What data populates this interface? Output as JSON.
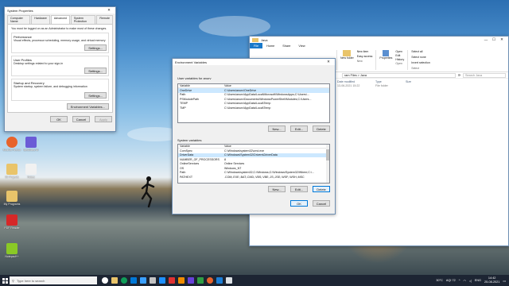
{
  "system_properties": {
    "title": "System Properties",
    "tabs": [
      "Computer Name",
      "Hardware",
      "Advanced",
      "System Protection",
      "Remote"
    ],
    "active_tab": "Advanced",
    "admin_note": "You must be logged on as an Administrator to make most of these changes.",
    "performance": {
      "label": "Performance",
      "desc": "Visual effects, processor scheduling, memory usage, and virtual memory",
      "button": "Settings..."
    },
    "user_profiles": {
      "label": "User Profiles",
      "desc": "Desktop settings related to your sign-in",
      "button": "Settings..."
    },
    "startup": {
      "label": "Startup and Recovery",
      "desc": "System startup, system failure, and debugging information",
      "button": "Settings..."
    },
    "env_button": "Environment Variables...",
    "ok": "OK",
    "cancel": "Cancel",
    "apply": "Apply"
  },
  "env_vars": {
    "title": "Environment Variables",
    "user_section": "User variables for anurv",
    "col_variable": "Variable",
    "col_value": "Value",
    "user_rows": [
      {
        "var": "OneDrive",
        "val": "C:\\Users\\anurv\\OneDrive"
      },
      {
        "var": "Path",
        "val": "C:\\Users\\anurv\\AppData\\Local\\Microsoft\\WindowsApps;C:\\Users\\..."
      },
      {
        "var": "PSModulePath",
        "val": "C:\\Users\\anurv\\Documents\\WindowsPowerShell\\Modules;C:\\Users..."
      },
      {
        "var": "TEMP",
        "val": "C:\\Users\\anurv\\AppData\\Local\\Temp"
      },
      {
        "var": "TMP",
        "val": "C:\\Users\\anurv\\AppData\\Local\\Temp"
      }
    ],
    "system_section": "System variables",
    "system_rows": [
      {
        "var": "ComSpec",
        "val": "C:\\Windows\\system32\\cmd.exe"
      },
      {
        "var": "DriverData",
        "val": "C:\\Windows\\System32\\Drivers\\DriverData"
      },
      {
        "var": "NUMBER_OF_PROCESSORS",
        "val": "8"
      },
      {
        "var": "OnlineServices",
        "val": "Online Services"
      },
      {
        "var": "OS",
        "val": "Windows_NT"
      },
      {
        "var": "Path",
        "val": "C:\\Windows\\system32;C:\\Windows;C:\\Windows\\System32\\Wbem;C:\\..."
      },
      {
        "var": "PATHEXT",
        "val": ".COM;.EXE;.BAT;.CMD;.VBS;.VBE;.JS;.JSE;.WSF;.WSH;.MSC"
      }
    ],
    "new": "New...",
    "edit": "Edit...",
    "delete": "Delete",
    "ok": "OK",
    "cancel": "Cancel"
  },
  "explorer": {
    "title": "Java",
    "ribbon_tabs": [
      "File",
      "Home",
      "Share",
      "View"
    ],
    "new_item": "New item",
    "easy_access": "Easy access",
    "new_folder": "New folder",
    "properties": "Properties",
    "open": "Open",
    "edit": "Edit",
    "history": "History",
    "select_all": "Select all",
    "select_none": "Select none",
    "invert_selection": "Invert selection",
    "organize": "Organize",
    "group_new": "New",
    "group_open": "Open",
    "group_select": "Select",
    "path": "ram Files > Java",
    "search_placeholder": "Search Java",
    "col_date": "Date modified",
    "col_type": "Type",
    "col_size": "Size",
    "file_date": "13-06-2021 15:22",
    "file_type": "File folder"
  },
  "desktop_icons": [
    {
      "label": "Mozilla Firefox",
      "color": "#e8632b"
    },
    {
      "label": "BeSkilled AI",
      "color": "#6b5bd6"
    },
    {
      "label": "00 Projects",
      "color": "#e9c46a"
    },
    {
      "label": "Notes",
      "color": "#f1f1f1"
    },
    {
      "label": "PDF Reader",
      "color": "#d62828"
    },
    {
      "label": "My Programs",
      "color": "#e9c46a"
    },
    {
      "label": "Notepad++",
      "color": "#8ac926"
    }
  ],
  "taskbar": {
    "search_placeholder": "Type here to search",
    "weather": "30°C",
    "aqi": "AQI 72",
    "lang": "ENG",
    "time": "14:42",
    "date": "25-08-2021"
  }
}
